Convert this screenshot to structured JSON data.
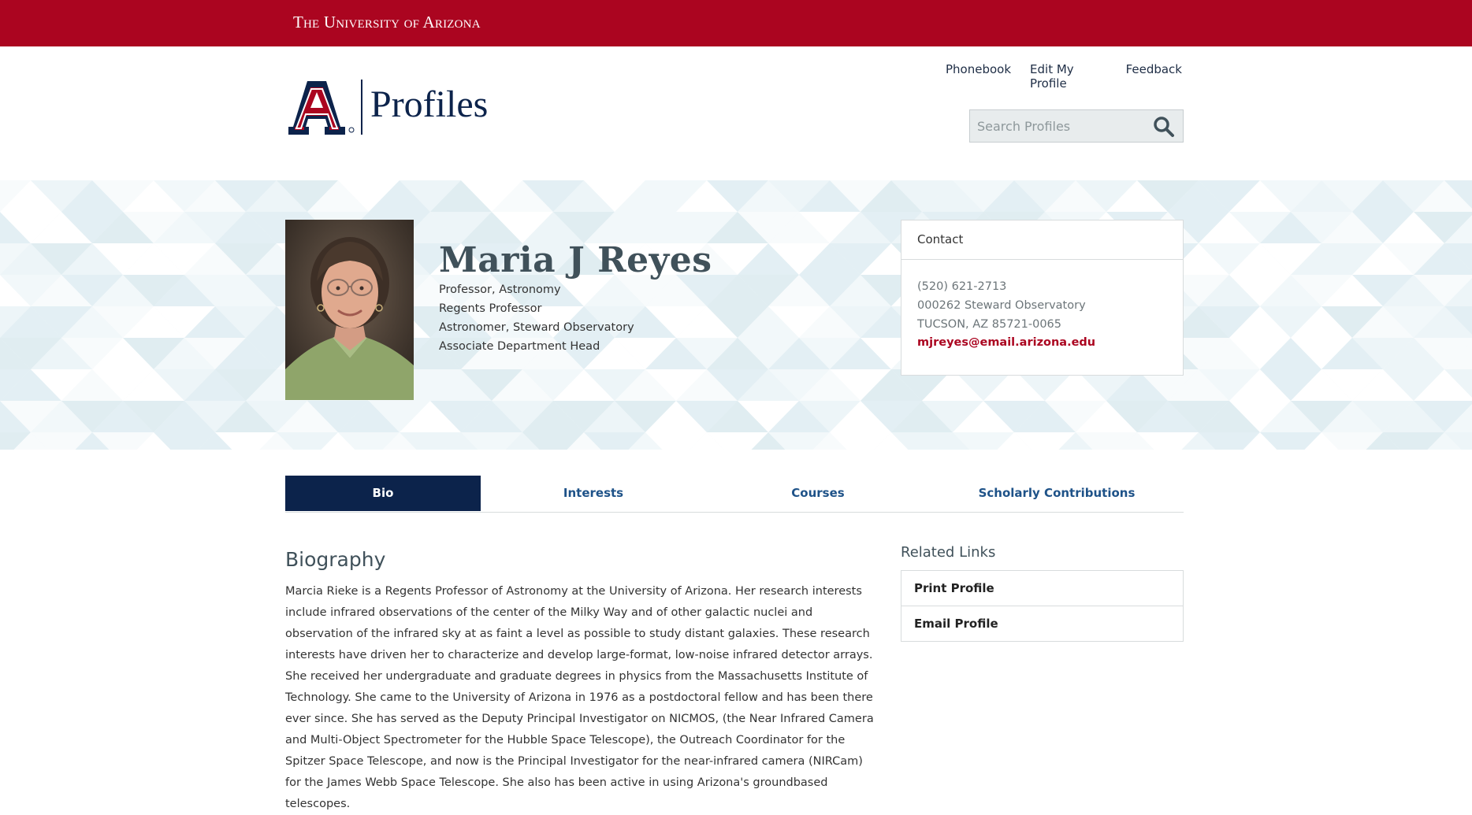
{
  "topbar": {
    "wordmark": "The University of Arizona"
  },
  "header": {
    "logo_text": "Profiles",
    "nav": [
      "Phonebook",
      "Edit My Profile",
      "Feedback"
    ],
    "search_placeholder": "Search Profiles"
  },
  "profile": {
    "name": "Maria J Reyes",
    "titles": [
      "Professor, Astronomy",
      "Regents Professor",
      "Astronomer, Steward Observatory",
      "Associate Department Head"
    ]
  },
  "contact": {
    "heading": "Contact",
    "phone": "(520) 621-2713",
    "address1": "000262 Steward Observatory",
    "address2": "TUCSON, AZ 85721-0065",
    "email": "mjreyes@email.arizona.edu"
  },
  "tabs": [
    "Bio",
    "Interests",
    "Courses",
    "Scholarly Contributions"
  ],
  "bio": {
    "heading": "Biography",
    "text": "Marcia Rieke is a Regents Professor of Astronomy at the University of  Arizona.  Her research interests include infrared observations of the center of the Milky Way and of other galactic nuclei and observation of the infrared sky at as faint a level as possible to study distant galaxies. These research interests have driven her to characterize and develop large-format, low-noise infrared detector arrays. She received her undergraduate and graduate degrees in physics from the Massachusetts Institute of Technology. She came to the University of Arizona in 1976 as a postdoctoral fellow and has been there ever since.   She has served as the Deputy Principal Investigator on NICMOS, (the Near Infrared Camera and Multi-Object Spectrometer for the Hubble Space Telescope), the Outreach Coordinator for the Spitzer Space Telescope, and now is the Principal Investigator for the near-infrared camera (NIRCam) for the James Webb Space Telescope.  She also has been active in using Arizona's groundbased telescopes."
  },
  "related": {
    "heading": "Related Links",
    "links": [
      "Print Profile",
      "Email Profile"
    ]
  },
  "colors": {
    "brand_red": "#ab0520",
    "brand_navy": "#0c234b",
    "tab_link": "#1e5288"
  },
  "icons": {
    "search": "search-icon",
    "logo": "ua-block-a-logo"
  }
}
